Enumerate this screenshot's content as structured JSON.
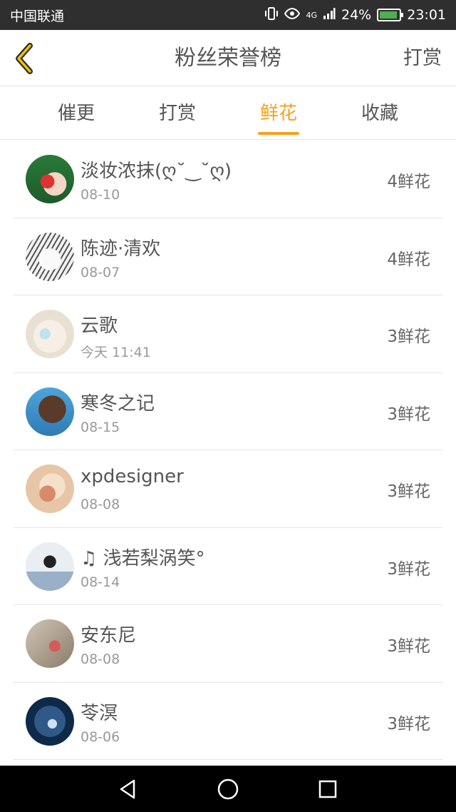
{
  "status_bar": {
    "carrier": "中国联通",
    "network": "4G",
    "battery": "24%",
    "time": "23:01"
  },
  "header": {
    "title": "粉丝荣誉榜",
    "action": "打赏"
  },
  "tabs": [
    {
      "label": "催更"
    },
    {
      "label": "打赏"
    },
    {
      "label": "鲜花"
    },
    {
      "label": "收藏"
    }
  ],
  "active_tab_color": "#f5a21d",
  "fans": [
    {
      "name": "淡妆浓抹(ღ˘‿˘ღ)",
      "date": "08-10",
      "count": "4鲜花"
    },
    {
      "name": "陈迹·清欢",
      "date": "08-07",
      "count": "4鲜花"
    },
    {
      "name": "云歌",
      "date": "今天 11:41",
      "count": "3鲜花"
    },
    {
      "name": "寒冬之记",
      "date": "08-15",
      "count": "3鲜花"
    },
    {
      "name": "xpdesigner",
      "date": "08-08",
      "count": "3鲜花"
    },
    {
      "name": "♫ 浅若梨涡笑°",
      "date": "08-14",
      "count": "3鲜花"
    },
    {
      "name": "安东尼",
      "date": "08-08",
      "count": "3鲜花"
    },
    {
      "name": "苓溟",
      "date": "08-06",
      "count": "3鲜花"
    }
  ]
}
